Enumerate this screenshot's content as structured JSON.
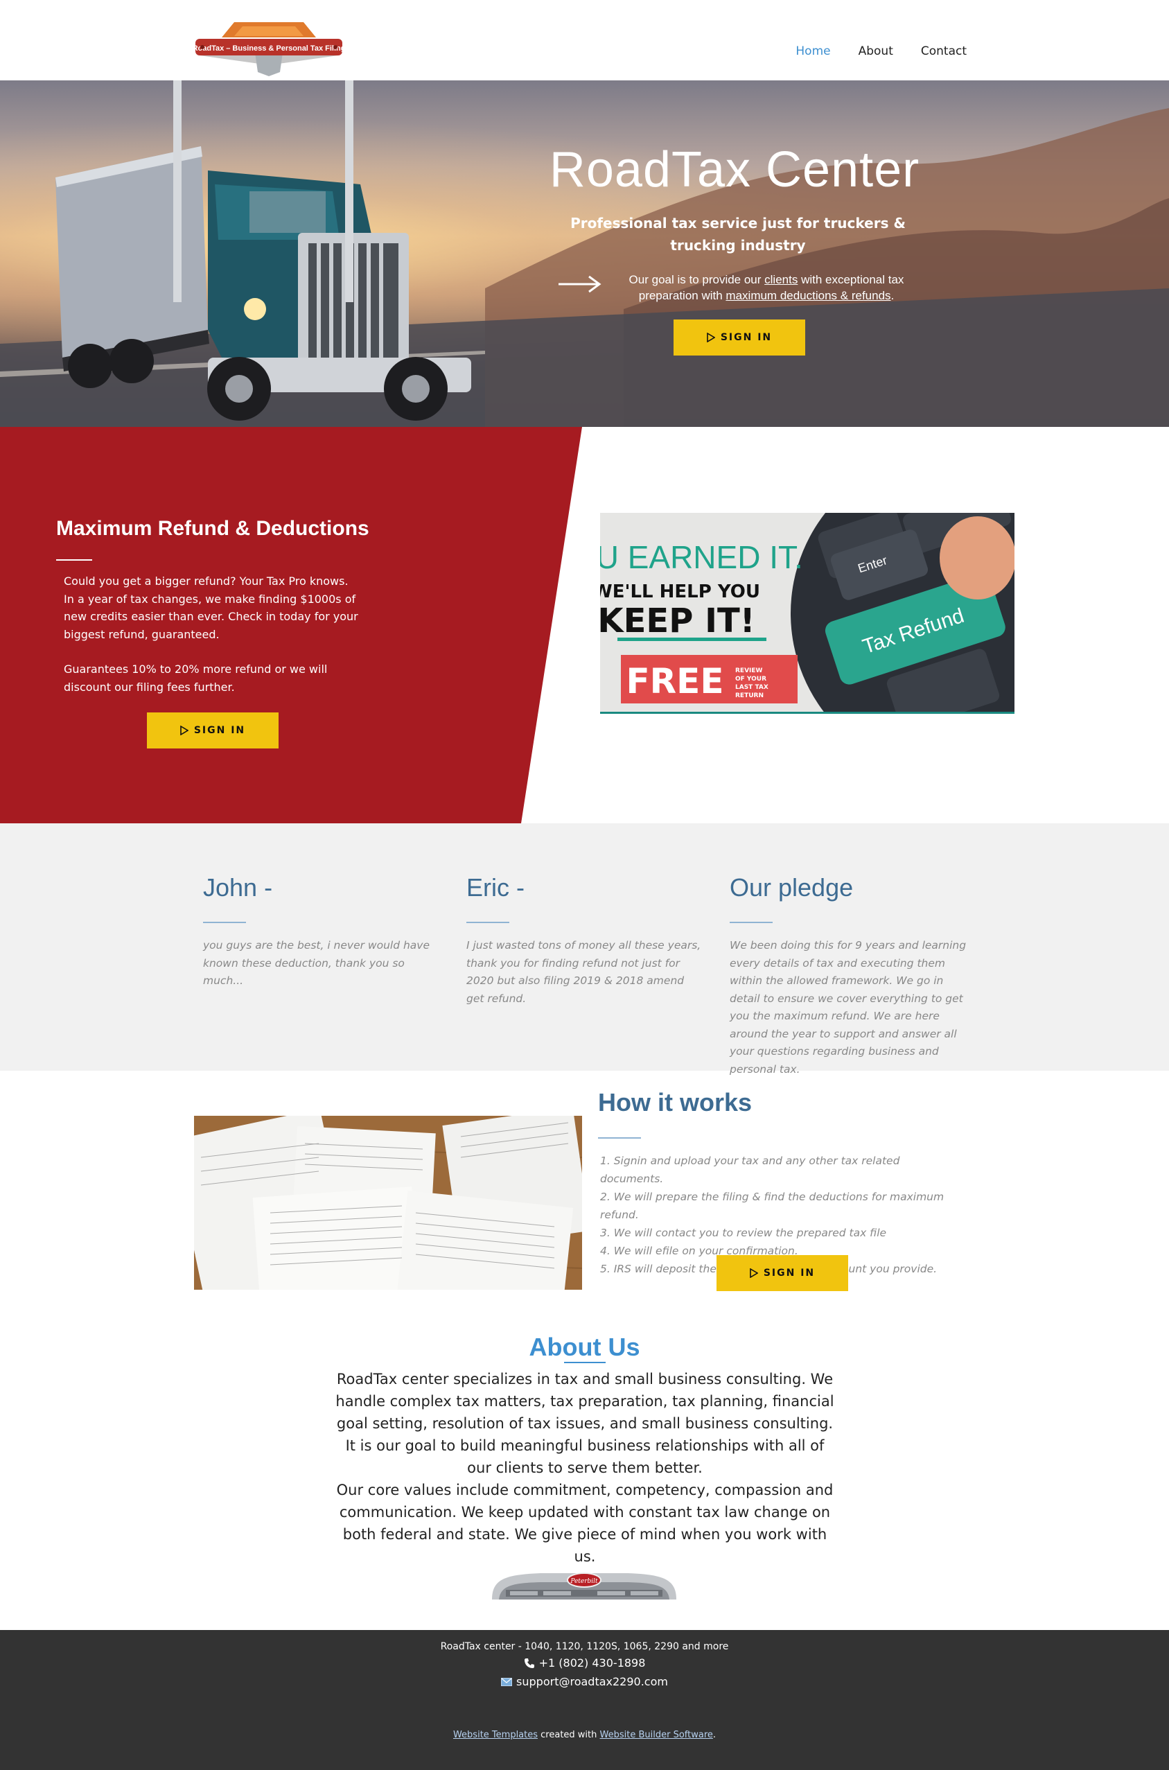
{
  "logo": {
    "text": "RoadTax – Business & Personal Tax Filing"
  },
  "nav": {
    "home": "Home",
    "about": "About",
    "contact": "Contact"
  },
  "hero": {
    "title": "RoadTax Center",
    "subtitle": "Professional tax service just for truckers & trucking industry",
    "goal_pre": "Our goal is to provide our ",
    "goal_link1": "clients",
    "goal_mid": " with exceptional tax preparation with ",
    "goal_link2": "maximum deductions & refunds",
    "goal_post": ".",
    "button": "SIGN IN"
  },
  "refund": {
    "title": "Maximum Refund & Deductions",
    "p1": "Could you get a bigger refund? Your Tax Pro knows.\nIn a year of tax changes, we make finding $1000s of new credits easier than ever. Check in today for your biggest refund, guaranteed.",
    "p2": "Guarantees 10% to 20% more refund or we will discount our filing fees further.",
    "button": "SIGN IN",
    "promo": {
      "line1": "YOU EARNED IT.",
      "line2": "WE'LL HELP YOU",
      "line3": "KEEP IT!",
      "free": "FREE",
      "free_note": "REVIEW OF YOUR LAST TAX RETURN",
      "key1": "Enter",
      "key2": "Tax Refund"
    }
  },
  "testimonials": [
    {
      "name": "John -",
      "text": "you guys are the best, i never would have known these deduction, thank you so much..."
    },
    {
      "name": "Eric -",
      "text": "I just wasted tons of money all these years, thank you for finding refund not just for 2020 but also filing 2019 & 2018 amend get refund."
    },
    {
      "name": "Our pledge",
      "text": "We been doing this for 9 years and learning every details of tax and executing them within the allowed framework. We go in detail to ensure we cover everything to get you the maximum refund. We are here around the year to support and answer all your questions regarding business and personal tax."
    }
  ],
  "how": {
    "title": "How it works",
    "steps": [
      "1. Signin and upload your tax and any other tax related documents.",
      "2. We will prepare the filing & find the deductions for maximum refund.",
      "3. We will contact you to review the prepared tax file",
      "4. We will efile on your confirmation.",
      "5. IRS will deposit the refund at the bank account you provide."
    ],
    "button": "SIGN IN"
  },
  "about": {
    "title": "About Us",
    "p1": "RoadTax center specializes in tax and small business consulting. We handle complex tax matters, tax preparation, tax planning, financial goal setting, resolution of tax issues, and small business consulting. It is our goal to build meaningful business relationships with all of our clients to serve them better.",
    "p2": "Our core values include commitment, competency, compassion and communication. We keep updated with constant tax law change on both federal and state. We give piece of mind when you work with us.",
    "badge": "Peterbilt"
  },
  "footer": {
    "line1": "RoadTax center - 1040, 1120, 1120S, 1065, 2290 and more",
    "phone": "+1 (802) 430-1898",
    "email": "support@roadtax2290.com",
    "link1": "Website Templates",
    "created": " created with ",
    "link2": "Website Builder Software",
    "end": "."
  },
  "colors": {
    "accent_blue": "#3d8fd0",
    "heading_blue": "#3d6b92",
    "red": "#a61b21",
    "yellow": "#f1c40f",
    "footer": "#333333"
  }
}
